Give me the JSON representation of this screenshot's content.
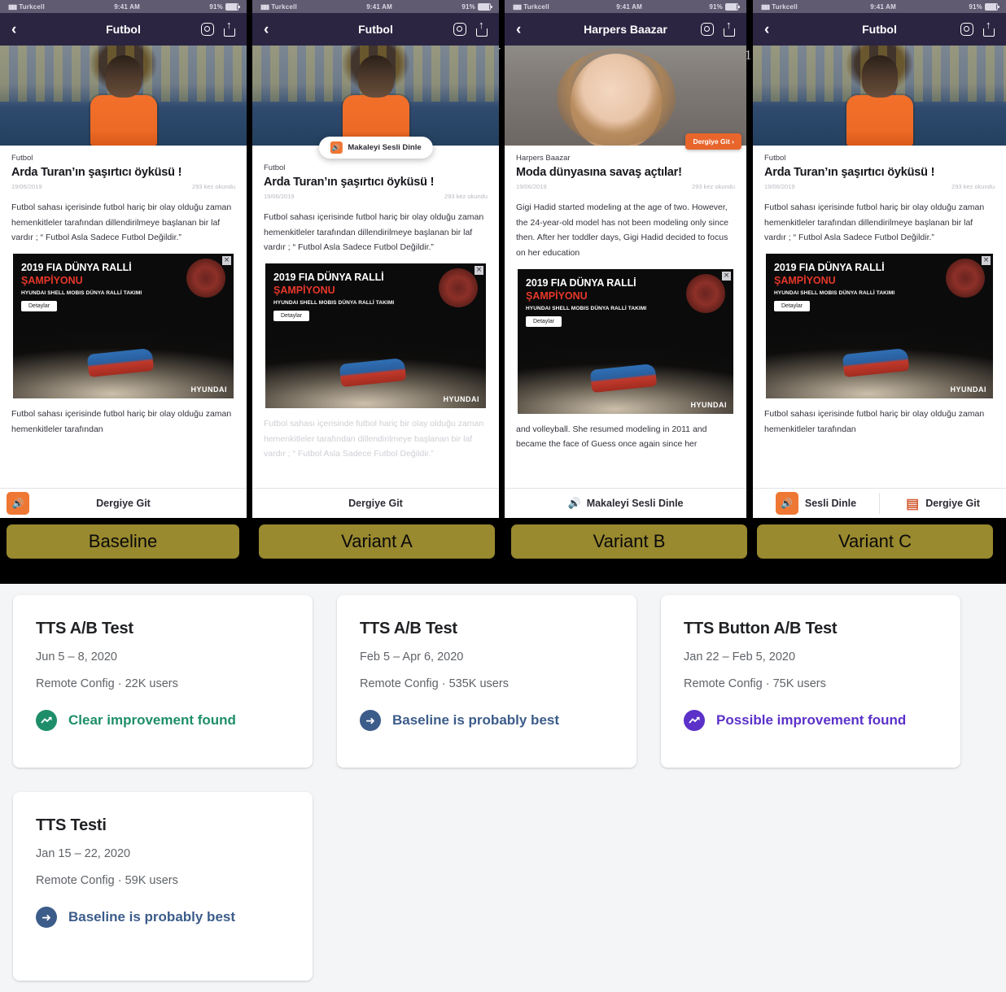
{
  "phones": [
    {
      "label": "Baseline",
      "status_bar": {
        "carrier": "Turkcell",
        "time": "9:41 AM",
        "battery": "91%"
      },
      "nav": {
        "back_icon": "chevron-left-icon",
        "title": "Futbol",
        "instagram_icon": "instagram-icon",
        "share_icon": "share-icon"
      },
      "article": {
        "category": "Futbol",
        "title": "Arda Turan’ın şaşırtıcı öyküsü !",
        "date": "19/06/2019",
        "reads": "293 kez okundu",
        "paragraph1": "Futbol sahası içerisinde futbol hariç bir olay olduğu zaman hemenkitleler tarafından dillendirilmeye başlanan bir laf vardır ; “ Futbol Asla Sadece Futbol Değildir.”",
        "paragraph2": "Futbol sahası içerisinde futbol hariç bir olay olduğu zaman hemenkitleler tarafından"
      },
      "ad": {
        "line1": "2019 FIA DÜNYA RALLİ",
        "line2": "ŞAMPİYONU",
        "line3": "HYUNDAI SHELL MOBIS DÜNYA RALLİ TAKIMI",
        "button": "Detaylar",
        "brand": "HYUNDAI",
        "close": "×"
      },
      "bottom": {
        "type": "icon-plus-label",
        "speaker_icon": "speaker-icon",
        "label": "Dergiye Git"
      }
    },
    {
      "label": "Variant A",
      "status_bar": {
        "carrier": "Turkcell",
        "time": "9:41 AM",
        "battery": "91%"
      },
      "nav": {
        "back_icon": "chevron-left-icon",
        "title": "Futbol",
        "instagram_icon": "instagram-icon",
        "share_icon": "share-icon"
      },
      "floating_pill": {
        "speaker_icon": "speaker-icon",
        "label": "Makaleyi Sesli Dinle"
      },
      "article": {
        "category": "Futbol",
        "title": "Arda Turan’ın şaşırtıcı öyküsü !",
        "date": "19/06/2019",
        "reads": "293 kez okundu",
        "paragraph1": "Futbol sahası içerisinde futbol hariç bir olay olduğu zaman hemenkitleler tarafından dillendirilmeye başlanan bir laf vardır ; “ Futbol Asla Sadece Futbol Değildir.”",
        "paragraph2": "Futbol sahası içerisinde futbol hariç bir olay olduğu zaman hemenkitleler tarafından"
      },
      "ad": {
        "line1": "2019 FIA DÜNYA RALLİ",
        "line2": "ŞAMPİYONU",
        "line3": "HYUNDAI SHELL MOBIS DÜNYA RALLİ TAKIMI",
        "button": "Detaylar",
        "brand": "HYUNDAI",
        "close": "×"
      },
      "bottom": {
        "type": "label-only",
        "label": "Dergiye Git"
      }
    },
    {
      "label": "Variant B",
      "status_bar": {
        "carrier": "Turkcell",
        "time": "9:41 AM",
        "battery": "91%"
      },
      "nav": {
        "back_icon": "chevron-left-icon",
        "title": "Harpers Baazar",
        "instagram_icon": "instagram-icon",
        "share_icon": "share-icon"
      },
      "orange_cta": "Dergiye Git ›",
      "article": {
        "category": "Harpers Baazar",
        "title": "Moda dünyasına savaş açtılar!",
        "date": "19/06/2019",
        "reads": "293 kez okundu",
        "paragraph1": "Gigi Hadid started modeling at the age of two. However, the 24-year-old model has not been modeling only since then.  After her toddler days, Gigi Hadid decided to focus on her education",
        "paragraph2": "and volleyball. She resumed modeling in 2011 and became the face of Guess once again since her"
      },
      "ad": {
        "line1": "2019 FIA DÜNYA RALLİ",
        "line2": "ŞAMPİYONU",
        "line3": "HYUNDAI SHELL MOBIS DÜNYA RALLİ TAKIMI",
        "button": "Detaylar",
        "brand": "HYUNDAI",
        "close": "×"
      },
      "bottom": {
        "type": "audio-label",
        "speaker_icon": "speaker-icon",
        "label": "Makaleyi Sesli Dinle"
      }
    },
    {
      "label": "Variant C",
      "status_bar": {
        "carrier": "Turkcell",
        "time": "9:41 AM",
        "battery": "91%"
      },
      "nav": {
        "back_icon": "chevron-left-icon",
        "title": "Futbol",
        "instagram_icon": "instagram-icon",
        "share_icon": "share-icon"
      },
      "article": {
        "category": "Futbol",
        "title": "Arda Turan’ın şaşırtıcı öyküsü !",
        "date": "19/06/2019",
        "reads": "293 kez okundu",
        "paragraph1": "Futbol sahası içerisinde futbol hariç bir olay olduğu zaman hemenkitleler tarafından dillendirilmeye başlanan bir laf vardır ; “ Futbol Asla Sadece Futbol Değildir.”",
        "paragraph2": "Futbol sahası içerisinde futbol hariç bir olay olduğu zaman hemenkitleler tarafından"
      },
      "ad": {
        "line1": "2019 FIA DÜNYA RALLİ",
        "line2": "ŞAMPİYONU",
        "line3": "HYUNDAI SHELL MOBIS DÜNYA RALLİ TAKIMI",
        "button": "Detaylar",
        "brand": "HYUNDAI",
        "close": "×"
      },
      "bottom": {
        "type": "two-buttons",
        "speaker_icon": "speaker-icon",
        "left_label": "Sesli Dinle",
        "document_icon": "document-icon",
        "right_label": "Dergiye Git"
      }
    }
  ],
  "gap_glyphs": {
    "after_variant_a": "V",
    "after_variant_b": "1"
  },
  "experiments": [
    {
      "title": "TTS A/B Test",
      "dates": "Jun 5 – 8, 2020",
      "subtitle": "Remote Config · 22K users",
      "status": "Clear improvement found",
      "status_icon": "trending-up-icon",
      "status_color": "#1e8e6a"
    },
    {
      "title": "TTS A/B Test",
      "dates": "Feb 5 – Apr 6, 2020",
      "subtitle": "Remote Config · 535K users",
      "status": "Baseline is probably best",
      "status_icon": "arrow-right-icon",
      "status_color": "#3c5c8a"
    },
    {
      "title": "TTS Button A/B Test",
      "dates": "Jan 22 – Feb 5, 2020",
      "subtitle": "Remote Config · 75K users",
      "status": "Possible improvement found",
      "status_icon": "trending-up-icon",
      "status_color": "#5b31c9"
    },
    {
      "title": "TTS Testi",
      "dates": "Jan 15 – 22, 2020",
      "subtitle": "Remote Config · 59K users",
      "status": "Baseline is probably best",
      "status_icon": "arrow-right-icon",
      "status_color": "#3c5c8a"
    }
  ],
  "theme": {
    "navbar": "#2b2542",
    "label_chip": "#99892f",
    "accent_orange": "#ee7733",
    "page_bg": "#f4f5f7"
  }
}
